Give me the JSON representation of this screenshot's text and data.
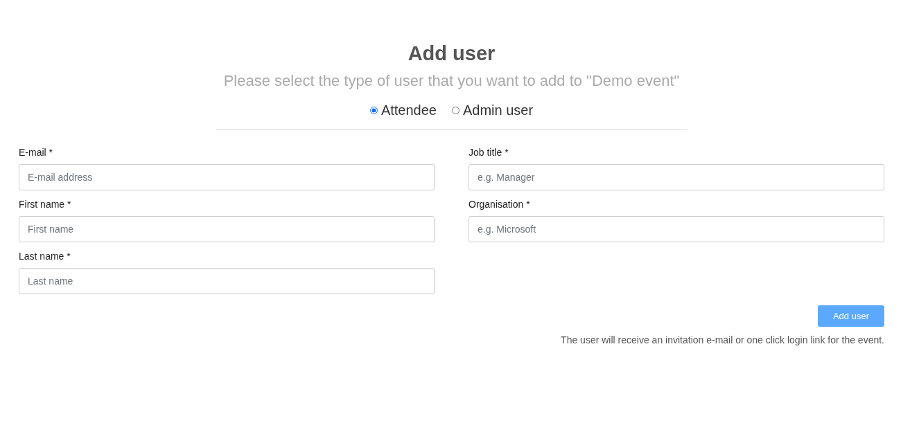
{
  "title": "Add user",
  "subtitle": "Please select the type of user that you want to add to \"Demo event\"",
  "user_types": [
    {
      "label": "Attendee",
      "selected": true
    },
    {
      "label": "Admin user",
      "selected": false
    }
  ],
  "left_fields": [
    {
      "label": "E-mail *",
      "placeholder": "E-mail address"
    },
    {
      "label": "First name *",
      "placeholder": "First name"
    },
    {
      "label": "Last name *",
      "placeholder": "Last name"
    }
  ],
  "right_fields": [
    {
      "label": "Job title *",
      "placeholder": "e.g. Manager"
    },
    {
      "label": "Organisation *",
      "placeholder": "e.g. Microsoft"
    }
  ],
  "submit": {
    "label": "Add user",
    "disabled": true
  },
  "note": "The user will receive an invitation e-mail or one click login link for the event."
}
